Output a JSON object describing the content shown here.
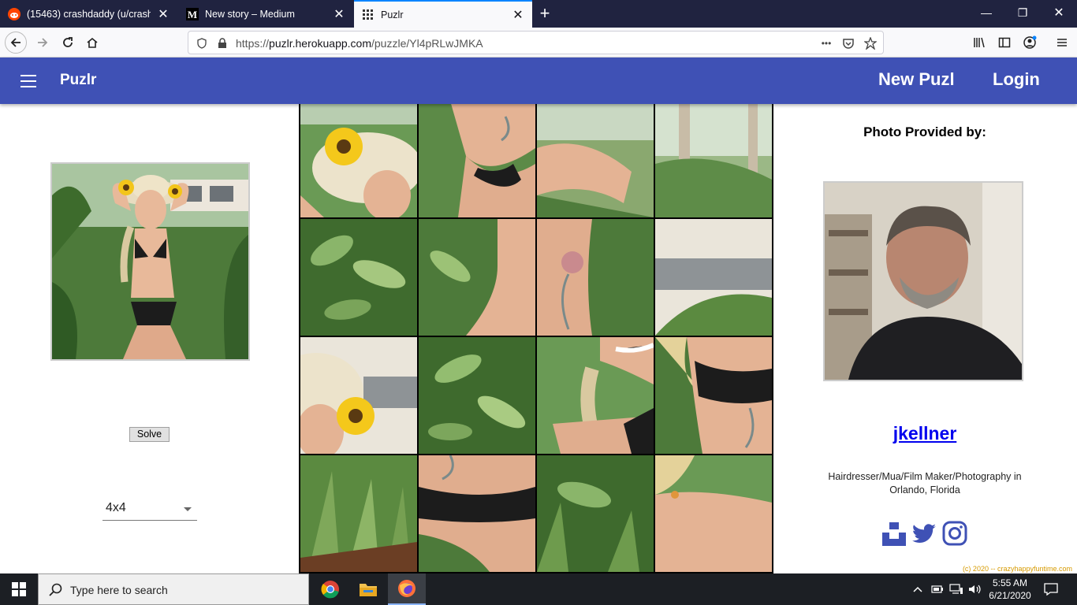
{
  "browser": {
    "tabs": [
      {
        "title": "(15463) crashdaddy (u/crashdaddy)",
        "icon": "reddit-icon",
        "active": false
      },
      {
        "title": "New story – Medium",
        "icon": "medium-icon",
        "active": false
      },
      {
        "title": "Puzlr",
        "icon": "puzlr-grid-icon",
        "active": true
      }
    ],
    "url_prefix": "https://",
    "url_host": "puzlr.herokuapp.com",
    "url_path": "/puzzle/Yl4pRLwJMKA",
    "menu_dots": "•••"
  },
  "app": {
    "title": "Puzlr",
    "new_button": "New Puzl",
    "login_button": "Login",
    "accent_color": "#3f51b5"
  },
  "left": {
    "solve_label": "Solve",
    "size_selected": "4x4"
  },
  "puzzle": {
    "rows": 4,
    "cols": 4,
    "tile_count": 16
  },
  "right": {
    "provided_label": "Photo Provided by:",
    "username": "jkellner",
    "bio": "Hairdresser/Mua/Film Maker/Photography in Orlando, Florida",
    "socials": [
      "unsplash-icon",
      "twitter-icon",
      "instagram-icon"
    ],
    "copyright": "(c) 2020 -- crazyhappyfuntime.com"
  },
  "taskbar": {
    "search_placeholder": "Type here to search",
    "time": "5:55 AM",
    "date": "6/21/2020"
  }
}
